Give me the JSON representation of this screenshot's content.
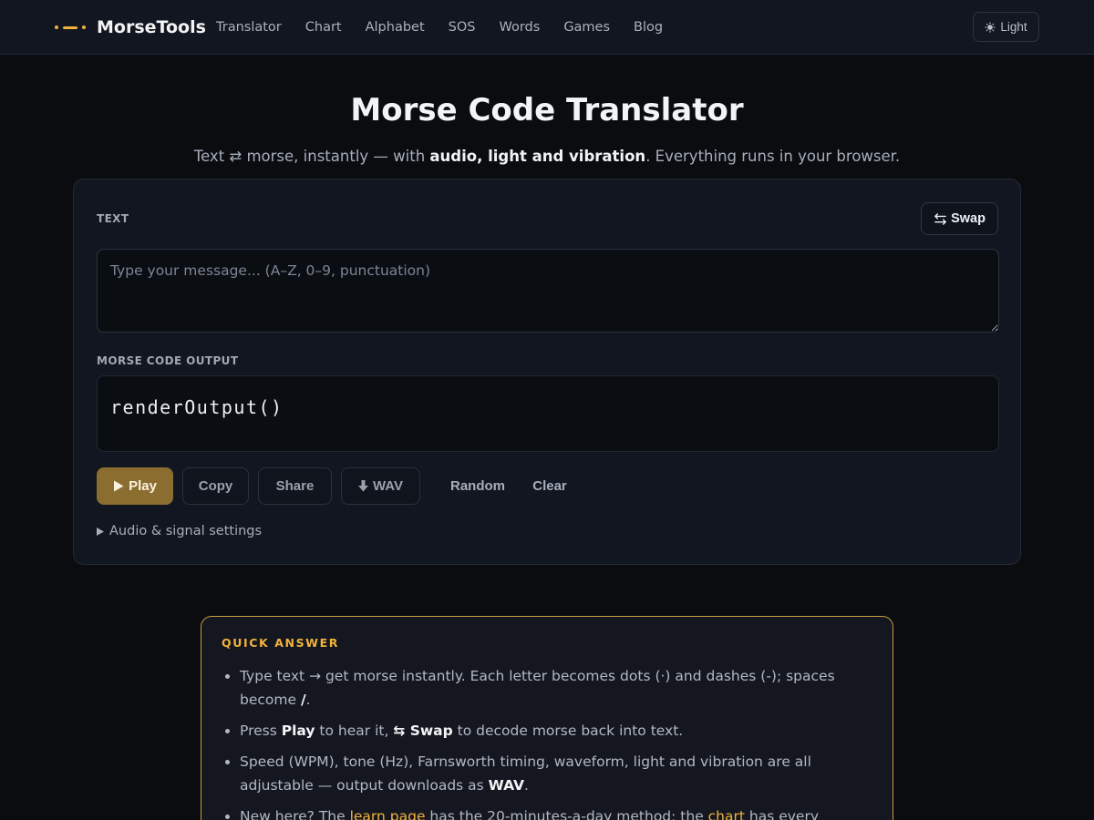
{
  "nav": {
    "brand": "MorseTools",
    "links": [
      "Translator",
      "Chart",
      "Alphabet",
      "SOS",
      "Words",
      "Games",
      "Blog"
    ],
    "theme_label": "Light"
  },
  "hero": {
    "title": "Morse Code Translator",
    "subtitle_pre": "Text ⇄ morse, instantly — with ",
    "subtitle_bold": "audio, light and vibration",
    "subtitle_post": ". Everything runs in your browser."
  },
  "translator": {
    "text_label": "TEXT",
    "swap_label": "Swap",
    "input_placeholder": "Type your message... (A–Z, 0–9, punctuation)",
    "input_value": "",
    "output_label": "MORSE CODE OUTPUT",
    "output_value": "renderOutput()",
    "buttons": {
      "play": "Play",
      "copy": "Copy",
      "share": "Share",
      "wav": "WAV",
      "random": "Random",
      "clear": "Clear"
    },
    "settings_label": "Audio & signal settings"
  },
  "quick_answer": {
    "title": "QUICK ANSWER",
    "item1_pre": "Type text → get morse instantly. Each letter becomes dots (·) and dashes (-); spaces become ",
    "item1_bold": "/",
    "item1_post": ".",
    "item2_a": "Press ",
    "item2_b": "Play",
    "item2_c": " to hear it, ",
    "item2_d": "⇆ Swap",
    "item2_e": " to decode morse back into text.",
    "item3_pre": "Speed (WPM), tone (Hz), Farnsworth timing, waveform, light and vibration are all adjustable — output downloads as ",
    "item3_bold": "WAV",
    "item3_post": ".",
    "item4_a": "New here? The ",
    "item4_link1": "learn page",
    "item4_b": " has the 20-minutes-a-day method; the ",
    "item4_link2": "chart",
    "item4_c": " has every character"
  },
  "colors": {
    "accent": "#f2b33d",
    "play_button": "#8b6d2f",
    "background": "#0a0c10",
    "card": "#111620"
  }
}
